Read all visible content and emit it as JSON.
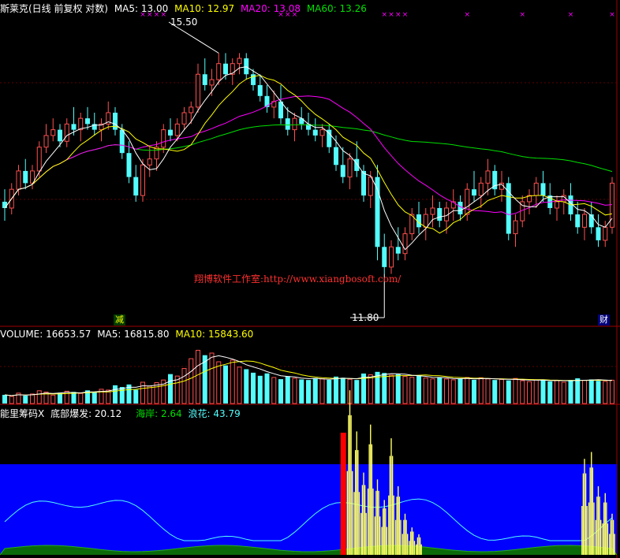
{
  "header": {
    "price_label": "斯莱克(日线 前复权 对数)",
    "ma5": "MA5: 13.00",
    "ma10": "MA10: 12.97",
    "ma20": "MA20: 13.08",
    "ma60": "MA60: 13.26"
  },
  "volume_header": {
    "volume": "VOLUME: 16653.57",
    "ma5": "MA5: 16815.80",
    "ma10": "MA10: 15843.60"
  },
  "indicator_header": {
    "name": "能里筹码X",
    "bottom": "底部爆发: 20.12",
    "coast": "海岸: 2.64",
    "wave": "浪花: 43.79"
  },
  "annotations": {
    "high": "15.50",
    "low": "11.80",
    "watermark": "翔博软件工作室:http://www.xiangbosoft.com/",
    "tag_left": "减",
    "tag_right": "财",
    "signal_mark": "×"
  },
  "colors": {
    "up": "#ff5050",
    "down": "#54fcfc",
    "ma5": "#ffffff",
    "ma10": "#ffff00",
    "ma20": "#ff00ff",
    "ma60": "#00e000",
    "panel_blue": "#0000ff",
    "bar_yellow": "#ffff66",
    "bar_red": "#ff0000"
  },
  "chart_data": {
    "type": "candlestick",
    "price_range": [
      11.3,
      16.2
    ],
    "price_scale": "log",
    "candles": [
      [
        12.9,
        13.1,
        12.6,
        12.8
      ],
      [
        12.8,
        13.2,
        12.7,
        13.1
      ],
      [
        13.1,
        13.5,
        13.0,
        13.4
      ],
      [
        13.4,
        13.6,
        13.1,
        13.2
      ],
      [
        13.2,
        13.5,
        13.1,
        13.4
      ],
      [
        13.4,
        13.9,
        13.3,
        13.8
      ],
      [
        13.8,
        14.2,
        13.7,
        14.0
      ],
      [
        14.0,
        14.3,
        13.9,
        14.1
      ],
      [
        14.1,
        14.2,
        13.8,
        13.9
      ],
      [
        13.9,
        14.3,
        13.8,
        14.2
      ],
      [
        14.2,
        14.5,
        14.0,
        14.1
      ],
      [
        14.1,
        14.4,
        13.9,
        14.3
      ],
      [
        14.3,
        14.5,
        14.1,
        14.2
      ],
      [
        14.2,
        14.4,
        14.0,
        14.1
      ],
      [
        14.1,
        14.3,
        13.9,
        14.2
      ],
      [
        14.2,
        14.6,
        14.1,
        14.4
      ],
      [
        14.4,
        14.5,
        14.0,
        14.1
      ],
      [
        14.1,
        14.2,
        13.6,
        13.7
      ],
      [
        13.7,
        13.9,
        13.2,
        13.3
      ],
      [
        13.3,
        13.5,
        12.9,
        13.0
      ],
      [
        13.0,
        13.6,
        12.9,
        13.5
      ],
      [
        13.5,
        13.8,
        13.3,
        13.6
      ],
      [
        13.6,
        13.9,
        13.4,
        13.8
      ],
      [
        13.8,
        14.2,
        13.7,
        14.1
      ],
      [
        14.1,
        14.3,
        13.9,
        14.0
      ],
      [
        14.0,
        14.3,
        13.9,
        14.2
      ],
      [
        14.2,
        14.5,
        14.1,
        14.4
      ],
      [
        14.4,
        14.6,
        14.2,
        14.5
      ],
      [
        14.5,
        15.3,
        14.4,
        15.1
      ],
      [
        15.1,
        15.4,
        14.8,
        14.9
      ],
      [
        14.9,
        15.2,
        14.7,
        15.0
      ],
      [
        15.0,
        15.5,
        14.9,
        15.3
      ],
      [
        15.3,
        15.5,
        15.0,
        15.1
      ],
      [
        15.1,
        15.4,
        14.9,
        15.3
      ],
      [
        15.3,
        15.5,
        15.1,
        15.4
      ],
      [
        15.4,
        15.5,
        15.0,
        15.1
      ],
      [
        15.1,
        15.2,
        14.8,
        14.9
      ],
      [
        14.9,
        15.1,
        14.6,
        14.7
      ],
      [
        14.7,
        14.9,
        14.4,
        14.5
      ],
      [
        14.5,
        14.8,
        14.3,
        14.6
      ],
      [
        14.6,
        14.9,
        14.2,
        14.3
      ],
      [
        14.3,
        14.5,
        14.0,
        14.1
      ],
      [
        14.1,
        14.4,
        13.9,
        14.3
      ],
      [
        14.3,
        14.5,
        14.1,
        14.2
      ],
      [
        14.2,
        14.4,
        14.0,
        14.1
      ],
      [
        14.1,
        14.3,
        13.9,
        14.0
      ],
      [
        14.0,
        14.2,
        13.8,
        14.1
      ],
      [
        14.1,
        14.2,
        13.7,
        13.8
      ],
      [
        13.8,
        14.0,
        13.4,
        13.5
      ],
      [
        13.5,
        13.8,
        13.2,
        13.3
      ],
      [
        13.3,
        13.7,
        13.1,
        13.6
      ],
      [
        13.6,
        13.9,
        13.3,
        13.4
      ],
      [
        13.4,
        13.5,
        12.9,
        13.0
      ],
      [
        13.0,
        13.4,
        12.8,
        13.3
      ],
      [
        13.3,
        13.5,
        12.0,
        12.2
      ],
      [
        12.2,
        12.4,
        11.8,
        11.9
      ],
      [
        11.9,
        12.3,
        11.8,
        12.2
      ],
      [
        12.2,
        12.5,
        12.0,
        12.1
      ],
      [
        12.1,
        12.5,
        12.0,
        12.4
      ],
      [
        12.4,
        12.8,
        12.3,
        12.7
      ],
      [
        12.7,
        12.9,
        12.4,
        12.5
      ],
      [
        12.5,
        12.8,
        12.3,
        12.7
      ],
      [
        12.7,
        13.0,
        12.5,
        12.8
      ],
      [
        12.8,
        12.9,
        12.5,
        12.6
      ],
      [
        12.6,
        12.9,
        12.4,
        12.8
      ],
      [
        12.8,
        13.1,
        12.6,
        12.9
      ],
      [
        12.9,
        13.0,
        12.6,
        12.7
      ],
      [
        12.7,
        13.2,
        12.6,
        13.1
      ],
      [
        13.1,
        13.4,
        12.9,
        13.0
      ],
      [
        13.0,
        13.3,
        12.8,
        13.2
      ],
      [
        13.2,
        13.6,
        13.0,
        13.4
      ],
      [
        13.4,
        13.5,
        13.0,
        13.1
      ],
      [
        13.1,
        13.4,
        12.9,
        13.2
      ],
      [
        13.2,
        13.3,
        12.3,
        12.4
      ],
      [
        12.4,
        12.7,
        12.2,
        12.6
      ],
      [
        12.6,
        13.0,
        12.5,
        12.9
      ],
      [
        12.9,
        13.1,
        12.7,
        13.0
      ],
      [
        13.0,
        13.3,
        12.8,
        13.2
      ],
      [
        13.2,
        13.4,
        12.9,
        13.0
      ],
      [
        13.0,
        13.2,
        12.7,
        12.8
      ],
      [
        12.8,
        13.0,
        12.6,
        12.9
      ],
      [
        12.9,
        13.1,
        12.7,
        13.0
      ],
      [
        13.0,
        13.2,
        12.6,
        12.7
      ],
      [
        12.7,
        12.9,
        12.4,
        12.5
      ],
      [
        12.5,
        12.8,
        12.3,
        12.7
      ],
      [
        12.7,
        12.9,
        12.4,
        12.5
      ],
      [
        12.5,
        12.7,
        12.2,
        12.3
      ],
      [
        12.3,
        12.6,
        12.2,
        12.5
      ],
      [
        12.5,
        13.3,
        12.4,
        13.2
      ]
    ],
    "volume_range": [
      0,
      45000
    ],
    "volumes": [
      6200,
      5100,
      7400,
      5600,
      6800,
      9100,
      8200,
      6000,
      7700,
      8800,
      8300,
      7200,
      9400,
      8100,
      10200,
      9600,
      13000,
      11800,
      13600,
      9800,
      15200,
      12400,
      14900,
      16800,
      21000,
      19600,
      25000,
      32000,
      38000,
      34500,
      36000,
      29800,
      27200,
      31000,
      26000,
      24500,
      22000,
      19800,
      21500,
      18600,
      17400,
      19500,
      18000,
      17200,
      16800,
      18200,
      17600,
      16900,
      19200,
      18400,
      17300,
      16800,
      21400,
      20500,
      22600,
      21800,
      20200,
      20900,
      19300,
      18700,
      19800,
      18200,
      17600,
      18800,
      17500,
      16900,
      17800,
      18600,
      16900,
      18400,
      17600,
      16800,
      17200,
      16500,
      17900,
      16300,
      15600,
      16900,
      17200,
      15800,
      16400,
      15200,
      16800,
      18000,
      16600,
      17200,
      16200,
      15800,
      16653.57
    ]
  }
}
